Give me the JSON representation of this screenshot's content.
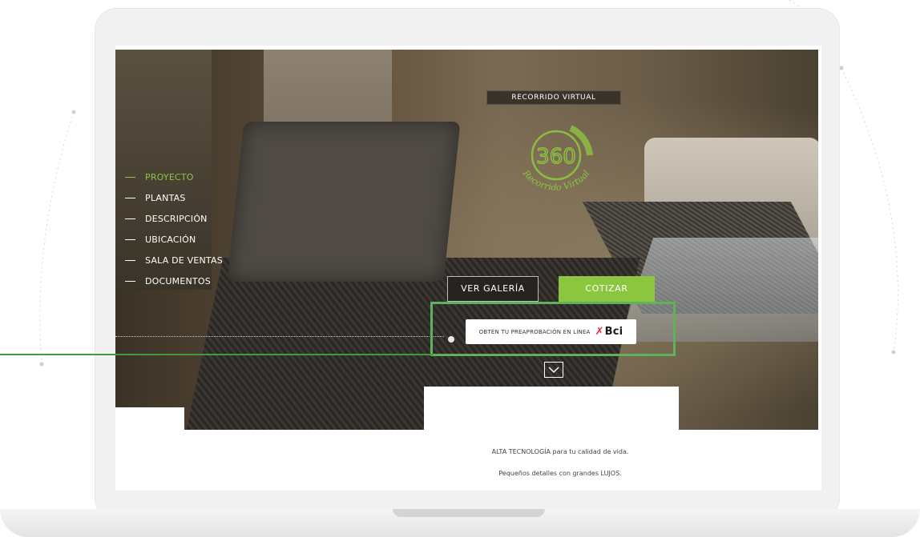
{
  "nav": {
    "items": [
      {
        "label": "PROYECTO",
        "active": true
      },
      {
        "label": "PLANTAS",
        "active": false
      },
      {
        "label": "DESCRIPCIÓN",
        "active": false
      },
      {
        "label": "UBICACIÓN",
        "active": false
      },
      {
        "label": "SALA DE VENTAS",
        "active": false
      },
      {
        "label": "DOCUMENTOS",
        "active": false
      }
    ]
  },
  "tour": {
    "label": "RECORRIDO VIRTUAL",
    "badge_number": "360",
    "badge_text": "Recorrido Virtual"
  },
  "buttons": {
    "gallery": "VER GALERÍA",
    "quote": "COTIZAR",
    "preapproval": "OBTÉN TU PREAPROBACIÓN EN LÍNEA",
    "bank_logo": "Bci"
  },
  "taglines": {
    "line1": "ALTA TECNOLOGÍA para tu calidad de vida.",
    "line2": "Pequeños detalles con grandes LUJOS."
  },
  "colors": {
    "accent": "#8cc63f",
    "highlight": "#5eb25b",
    "bci_red": "#e5322d"
  },
  "icons": {
    "chevron": "chevron-down-icon",
    "tour": "360-view-icon"
  }
}
